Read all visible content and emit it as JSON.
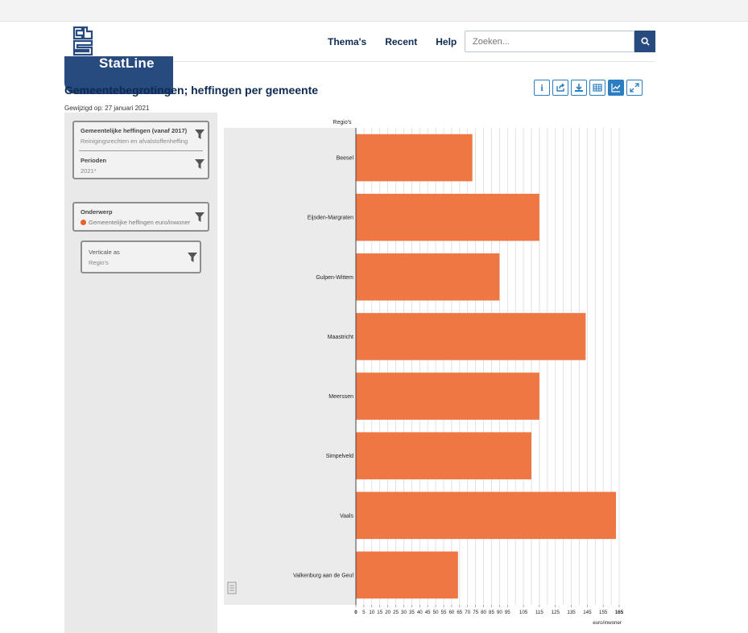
{
  "header": {
    "logo_text": "StatLine",
    "nav": [
      "Thema's",
      "Recent",
      "Help"
    ],
    "search_placeholder": "Zoeken..."
  },
  "page": {
    "title": "Gemeentebegrotingen; heffingen per gemeente",
    "modified": "Gewijzigd op: 27 januari 2021"
  },
  "toolbar": {
    "icons": [
      "info-icon",
      "share-icon",
      "download-icon",
      "table-icon",
      "chart-icon",
      "fullscreen-icon"
    ],
    "active": "chart-icon",
    "accent": "#2c7ec2"
  },
  "filters": {
    "heffingen": {
      "title": "Gemeentelijke heffingen (vanaf 2017)",
      "value": "Reinigingsrechten en afvalstoffenheffing"
    },
    "perioden": {
      "title": "Perioden",
      "value": "2021*"
    },
    "onderwerp": {
      "title": "Onderwerp",
      "value": "Gemeentelijke heffingen euro/inwoner"
    },
    "verticale_as": {
      "title": "Verticale as",
      "value": "Regio's"
    }
  },
  "chart_data": {
    "type": "bar",
    "orientation": "horizontal",
    "ylabel": "Regio's",
    "xlabel": "euro/inwoner",
    "categories": [
      "Beesel",
      "Eijsden-Margraten",
      "Gulpen-Wittem",
      "Maastricht",
      "Meerssen",
      "Simpelveld",
      "Vaals",
      "Valkenburg aan de Geul"
    ],
    "values": [
      73,
      115,
      90,
      144,
      115,
      110,
      163,
      64
    ],
    "xlim": [
      0,
      165
    ],
    "ticks": [
      "0",
      "5",
      "10",
      "15",
      "20",
      "25",
      "30",
      "35",
      "40",
      "45",
      "50",
      "55",
      "60",
      "65",
      "70",
      "75",
      "80",
      "85",
      "90",
      "95",
      "105",
      "115",
      "125",
      "135",
      "145",
      "155",
      "165"
    ],
    "tick_values": [
      0,
      5,
      10,
      15,
      20,
      25,
      30,
      35,
      40,
      45,
      50,
      55,
      60,
      65,
      70,
      75,
      80,
      85,
      90,
      95,
      105,
      115,
      125,
      135,
      145,
      155,
      165
    ],
    "grid_step": 5,
    "bar_color": "#ee7744",
    "grid": true
  }
}
